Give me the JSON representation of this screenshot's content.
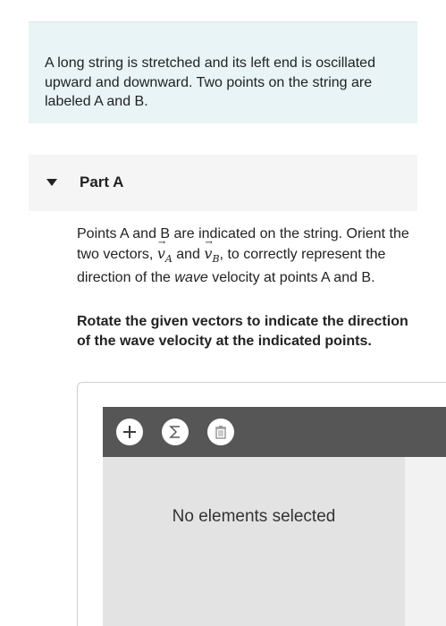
{
  "intro": {
    "text": "A long string is stretched and its left end is oscillated upward and downward. Two points on the string are labeled A and B."
  },
  "part": {
    "title": "Part A"
  },
  "question": {
    "text_1": "Points A and B are indicated on the string. Orient the two vectors, ",
    "vector_a_symbol": "v",
    "vector_a_sub": "A",
    "text_2": " and ",
    "vector_b_symbol": "v",
    "vector_b_sub": "B",
    "text_3": ", to correctly represent the direction of the ",
    "text_emph": "wave",
    "text_4": " velocity at points A and B."
  },
  "instruction": {
    "text": "Rotate the given vectors to indicate the direction of the wave velocity at the indicated points."
  },
  "tool": {
    "tools": [
      "add-icon",
      "sigma-icon",
      "trash-icon"
    ],
    "status": "No elements selected"
  },
  "colors": {
    "intro_bg": "#e8f4f5",
    "toolbar_bg": "#565656",
    "canvas_bg": "#e3e3e3"
  }
}
